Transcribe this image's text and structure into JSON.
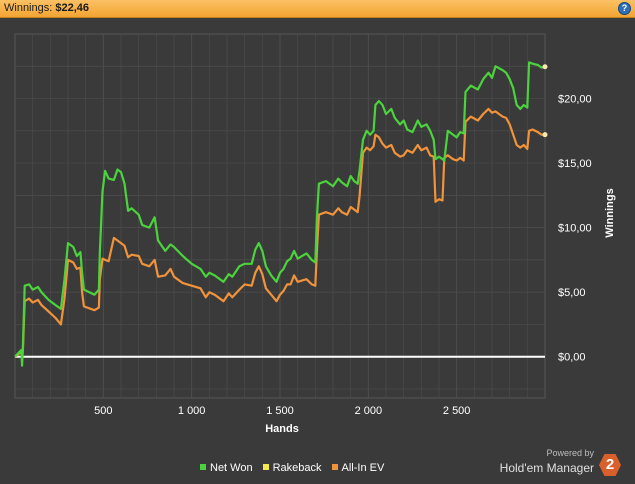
{
  "header": {
    "title_label": "Winnings:",
    "title_value": "$22,46",
    "help_label": "?"
  },
  "branding": {
    "powered_by": "Powered by",
    "name": "Hold'em Manager",
    "logo_text": "2"
  },
  "colors": {
    "background": "#3a3a3a",
    "header": "#f3a431",
    "net_won": "#4bd33d",
    "rakeback": "#f4e94a",
    "all_in_ev": "#f0933a",
    "zero_line": "#ffffff",
    "grid": "#4d4d4d"
  },
  "chart_data": {
    "type": "line",
    "xlabel": "Hands",
    "ylabel": "Winnings",
    "xlim": [
      0,
      3000
    ],
    "ylim": [
      -3.2,
      25
    ],
    "x_ticks": [
      500,
      1000,
      1500,
      2000,
      2500
    ],
    "x_tick_labels": [
      "500",
      "1 000",
      "1 500",
      "2 000",
      "2 500"
    ],
    "y_ticks": [
      0,
      5,
      10,
      15,
      20
    ],
    "y_tick_labels": [
      "$0,00",
      "$5,00",
      "$10,00",
      "$15,00",
      "$20,00"
    ],
    "grid": true,
    "legend_position": "bottom",
    "series": [
      {
        "name": "Net Won",
        "color": "#4bd33d",
        "points": [
          [
            0,
            0
          ],
          [
            20,
            0.3
          ],
          [
            35,
            0.5
          ],
          [
            40,
            -0.7
          ],
          [
            45,
            0.8
          ],
          [
            55,
            5.5
          ],
          [
            80,
            5.6
          ],
          [
            100,
            5.2
          ],
          [
            130,
            5.4
          ],
          [
            150,
            5.0
          ],
          [
            190,
            4.4
          ],
          [
            230,
            4.0
          ],
          [
            260,
            3.7
          ],
          [
            280,
            6.0
          ],
          [
            300,
            8.8
          ],
          [
            330,
            8.5
          ],
          [
            350,
            7.8
          ],
          [
            370,
            8.1
          ],
          [
            380,
            6.5
          ],
          [
            390,
            5.2
          ],
          [
            450,
            4.8
          ],
          [
            475,
            5.2
          ],
          [
            480,
            8.0
          ],
          [
            495,
            12.8
          ],
          [
            510,
            14.4
          ],
          [
            530,
            13.8
          ],
          [
            560,
            13.7
          ],
          [
            580,
            14.5
          ],
          [
            600,
            14.3
          ],
          [
            620,
            13.4
          ],
          [
            640,
            11.3
          ],
          [
            660,
            11.5
          ],
          [
            700,
            11.0
          ],
          [
            720,
            10.2
          ],
          [
            760,
            10.0
          ],
          [
            790,
            10.8
          ],
          [
            810,
            9.0
          ],
          [
            850,
            8.2
          ],
          [
            880,
            8.7
          ],
          [
            900,
            8.5
          ],
          [
            950,
            7.8
          ],
          [
            1000,
            7.2
          ],
          [
            1050,
            6.8
          ],
          [
            1080,
            6.2
          ],
          [
            1100,
            6.5
          ],
          [
            1130,
            6.3
          ],
          [
            1180,
            5.8
          ],
          [
            1210,
            6.4
          ],
          [
            1230,
            6.2
          ],
          [
            1270,
            7.0
          ],
          [
            1300,
            7.2
          ],
          [
            1340,
            7.2
          ],
          [
            1360,
            8.3
          ],
          [
            1380,
            8.8
          ],
          [
            1400,
            8.2
          ],
          [
            1420,
            7.0
          ],
          [
            1450,
            6.3
          ],
          [
            1480,
            5.8
          ],
          [
            1500,
            6.5
          ],
          [
            1520,
            6.8
          ],
          [
            1540,
            7.4
          ],
          [
            1560,
            7.6
          ],
          [
            1580,
            8.2
          ],
          [
            1600,
            7.6
          ],
          [
            1650,
            8.0
          ],
          [
            1680,
            7.5
          ],
          [
            1700,
            7.3
          ],
          [
            1710,
            11.0
          ],
          [
            1720,
            13.4
          ],
          [
            1760,
            13.6
          ],
          [
            1800,
            13.2
          ],
          [
            1830,
            13.8
          ],
          [
            1850,
            13.5
          ],
          [
            1880,
            13.2
          ],
          [
            1900,
            14.0
          ],
          [
            1920,
            13.6
          ],
          [
            1940,
            13.4
          ],
          [
            1950,
            14.4
          ],
          [
            1970,
            16.8
          ],
          [
            1990,
            17.5
          ],
          [
            2010,
            17.2
          ],
          [
            2030,
            17.5
          ],
          [
            2040,
            19.5
          ],
          [
            2060,
            19.8
          ],
          [
            2080,
            19.5
          ],
          [
            2100,
            18.8
          ],
          [
            2130,
            19.2
          ],
          [
            2150,
            18.5
          ],
          [
            2180,
            18.0
          ],
          [
            2200,
            18.3
          ],
          [
            2220,
            17.6
          ],
          [
            2250,
            17.4
          ],
          [
            2280,
            18.3
          ],
          [
            2300,
            17.8
          ],
          [
            2330,
            18.0
          ],
          [
            2350,
            17.5
          ],
          [
            2370,
            16.8
          ],
          [
            2380,
            15.3
          ],
          [
            2400,
            15.5
          ],
          [
            2430,
            15.2
          ],
          [
            2450,
            17.5
          ],
          [
            2480,
            17.2
          ],
          [
            2500,
            17.0
          ],
          [
            2520,
            17.4
          ],
          [
            2540,
            17.3
          ],
          [
            2550,
            20.5
          ],
          [
            2580,
            21.0
          ],
          [
            2620,
            20.7
          ],
          [
            2650,
            21.5
          ],
          [
            2680,
            22.0
          ],
          [
            2700,
            21.6
          ],
          [
            2720,
            22.5
          ],
          [
            2760,
            22.2
          ],
          [
            2780,
            22.0
          ],
          [
            2800,
            21.5
          ],
          [
            2820,
            20.8
          ],
          [
            2840,
            19.5
          ],
          [
            2860,
            19.2
          ],
          [
            2880,
            19.5
          ],
          [
            2900,
            19.3
          ],
          [
            2910,
            22.8
          ],
          [
            2930,
            22.7
          ],
          [
            2960,
            22.6
          ],
          [
            2980,
            22.4
          ],
          [
            3000,
            22.46
          ]
        ]
      },
      {
        "name": "Rakeback",
        "color": "#f4e94a",
        "points": [
          [
            0,
            0
          ],
          [
            3000,
            0
          ]
        ]
      },
      {
        "name": "All-In EV",
        "color": "#f0933a",
        "points": [
          [
            0,
            0
          ],
          [
            20,
            0.2
          ],
          [
            35,
            0.4
          ],
          [
            40,
            0.0
          ],
          [
            45,
            0.5
          ],
          [
            55,
            4.3
          ],
          [
            80,
            4.5
          ],
          [
            100,
            4.2
          ],
          [
            130,
            4.4
          ],
          [
            150,
            4.0
          ],
          [
            190,
            3.5
          ],
          [
            230,
            3.0
          ],
          [
            260,
            2.5
          ],
          [
            280,
            4.5
          ],
          [
            300,
            7.5
          ],
          [
            330,
            7.3
          ],
          [
            350,
            6.8
          ],
          [
            370,
            6.9
          ],
          [
            380,
            5.0
          ],
          [
            390,
            3.9
          ],
          [
            450,
            3.6
          ],
          [
            475,
            3.8
          ],
          [
            480,
            6.0
          ],
          [
            495,
            7.6
          ],
          [
            510,
            7.5
          ],
          [
            530,
            7.4
          ],
          [
            560,
            9.2
          ],
          [
            580,
            9.0
          ],
          [
            600,
            8.8
          ],
          [
            620,
            8.6
          ],
          [
            640,
            7.7
          ],
          [
            660,
            7.9
          ],
          [
            700,
            7.8
          ],
          [
            720,
            7.2
          ],
          [
            760,
            7.0
          ],
          [
            790,
            7.5
          ],
          [
            810,
            6.2
          ],
          [
            850,
            6.3
          ],
          [
            880,
            6.8
          ],
          [
            900,
            6.2
          ],
          [
            950,
            5.7
          ],
          [
            1000,
            5.5
          ],
          [
            1050,
            5.3
          ],
          [
            1080,
            4.6
          ],
          [
            1100,
            5.0
          ],
          [
            1130,
            4.8
          ],
          [
            1180,
            4.3
          ],
          [
            1210,
            4.9
          ],
          [
            1230,
            4.6
          ],
          [
            1270,
            5.2
          ],
          [
            1300,
            5.6
          ],
          [
            1340,
            5.5
          ],
          [
            1360,
            6.5
          ],
          [
            1380,
            7.0
          ],
          [
            1400,
            6.4
          ],
          [
            1420,
            5.3
          ],
          [
            1450,
            4.8
          ],
          [
            1480,
            4.3
          ],
          [
            1500,
            4.8
          ],
          [
            1520,
            5.1
          ],
          [
            1540,
            5.6
          ],
          [
            1560,
            5.6
          ],
          [
            1580,
            6.3
          ],
          [
            1600,
            5.8
          ],
          [
            1650,
            6.0
          ],
          [
            1680,
            5.6
          ],
          [
            1700,
            5.5
          ],
          [
            1710,
            8.5
          ],
          [
            1720,
            11.0
          ],
          [
            1760,
            11.2
          ],
          [
            1800,
            11.0
          ],
          [
            1830,
            11.5
          ],
          [
            1850,
            11.2
          ],
          [
            1880,
            11.0
          ],
          [
            1900,
            11.6
          ],
          [
            1920,
            11.4
          ],
          [
            1940,
            11.2
          ],
          [
            1950,
            12.4
          ],
          [
            1970,
            15.8
          ],
          [
            1990,
            16.2
          ],
          [
            2010,
            16.0
          ],
          [
            2030,
            16.3
          ],
          [
            2040,
            17.2
          ],
          [
            2060,
            17.0
          ],
          [
            2080,
            16.5
          ],
          [
            2100,
            16.2
          ],
          [
            2130,
            16.4
          ],
          [
            2150,
            15.8
          ],
          [
            2180,
            15.5
          ],
          [
            2200,
            15.6
          ],
          [
            2220,
            16.0
          ],
          [
            2250,
            15.8
          ],
          [
            2280,
            16.4
          ],
          [
            2300,
            16.0
          ],
          [
            2330,
            16.2
          ],
          [
            2350,
            15.6
          ],
          [
            2370,
            15.5
          ],
          [
            2380,
            12.0
          ],
          [
            2400,
            12.2
          ],
          [
            2420,
            12.1
          ],
          [
            2430,
            15.4
          ],
          [
            2450,
            15.6
          ],
          [
            2480,
            15.3
          ],
          [
            2500,
            15.2
          ],
          [
            2520,
            15.4
          ],
          [
            2540,
            15.2
          ],
          [
            2550,
            18.2
          ],
          [
            2580,
            18.6
          ],
          [
            2620,
            18.3
          ],
          [
            2650,
            18.8
          ],
          [
            2680,
            19.2
          ],
          [
            2700,
            18.9
          ],
          [
            2720,
            19.0
          ],
          [
            2760,
            18.6
          ],
          [
            2780,
            18.5
          ],
          [
            2800,
            18.0
          ],
          [
            2820,
            17.2
          ],
          [
            2840,
            16.4
          ],
          [
            2860,
            16.2
          ],
          [
            2880,
            16.4
          ],
          [
            2900,
            16.1
          ],
          [
            2910,
            17.5
          ],
          [
            2930,
            17.6
          ],
          [
            2960,
            17.4
          ],
          [
            2980,
            17.2
          ],
          [
            3000,
            17.2
          ]
        ]
      }
    ]
  }
}
